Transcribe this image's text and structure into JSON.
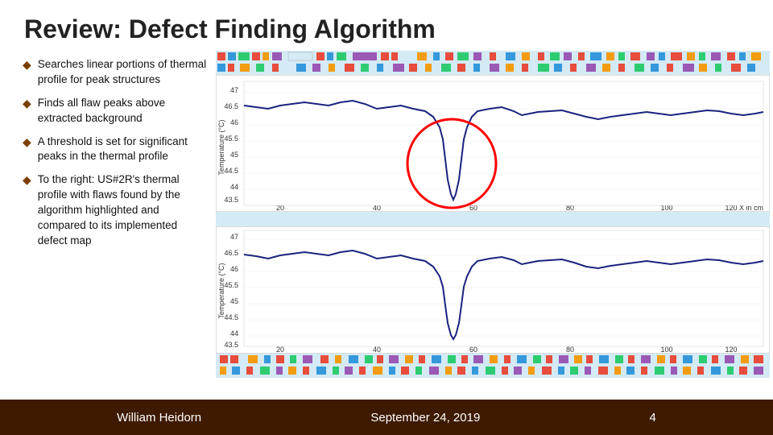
{
  "slide": {
    "title": "Review: Defect Finding Algorithm",
    "bullets": [
      {
        "id": "bullet1",
        "text": "Searches linear portions of thermal profile for peak structures"
      },
      {
        "id": "bullet2",
        "text": "Finds all flaw peaks above extracted background"
      },
      {
        "id": "bullet3",
        "text": "A threshold is set for significant peaks in the thermal profile"
      },
      {
        "id": "bullet4",
        "text": "To the right: US#2R's thermal profile with flaws found by the algorithm highlighted and compared to its implemented defect map"
      }
    ],
    "footer": {
      "author": "William Heidorn",
      "date": "September 24, 2019",
      "page": "4"
    }
  }
}
